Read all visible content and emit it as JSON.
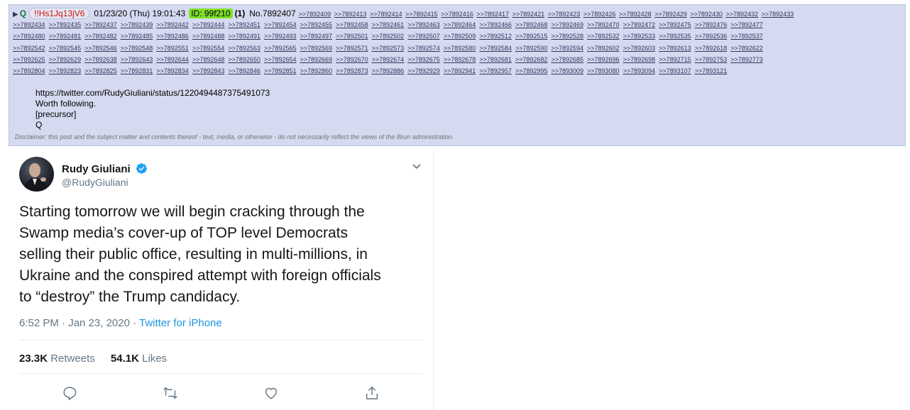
{
  "post": {
    "marker": "▶",
    "name": "Q",
    "tripcode": "!!Hs1Jq13jV6",
    "date": "01/23/20 (Thu) 19:01:43",
    "id_label": "ID: 99f210",
    "count": "(1)",
    "number": "No.7892407",
    "head_replies": [
      ">>7892409",
      ">>7892413",
      ">>7892414",
      ">>7892415",
      ">>7892416",
      ">>7892417",
      ">>7892421",
      ">>7892423",
      ">>7892426",
      ">>7892428",
      ">>7892429",
      ">>7892430",
      ">>7892432",
      ">>7892433"
    ],
    "reply_rows": [
      [
        ">>7892434",
        ">>7892435",
        ">>7892437",
        ">>7892439",
        ">>7892442",
        ">>7892444",
        ">>7892451",
        ">>7892454",
        ">>7892455",
        ">>7892458",
        ">>7892461",
        ">>7892463",
        ">>7892464",
        ">>7892466",
        ">>7892468",
        ">>7892469",
        ">>7892470",
        ">>7892472",
        ">>7892475",
        ">>7892476",
        ">>7892477"
      ],
      [
        ">>7892480",
        ">>7892481",
        ">>7892482",
        ">>7892485",
        ">>7892486",
        ">>7892488",
        ">>7892491",
        ">>7892493",
        ">>7892497",
        ">>7892501",
        ">>7892502",
        ">>7892507",
        ">>7892509",
        ">>7892512",
        ">>7892515",
        ">>7892528",
        ">>7892532",
        ">>7892533",
        ">>7892535",
        ">>7892536",
        ">>7892537"
      ],
      [
        ">>7892542",
        ">>7892545",
        ">>7892546",
        ">>7892548",
        ">>7892551",
        ">>7892554",
        ">>7892563",
        ">>7892565",
        ">>7892569",
        ">>7892571",
        ">>7892573",
        ">>7892574",
        ">>7892580",
        ">>7892584",
        ">>7892590",
        ">>7892594",
        ">>7892602",
        ">>7892603",
        ">>7892613",
        ">>7892618",
        ">>7892622"
      ],
      [
        ">>7892625",
        ">>7892629",
        ">>7892638",
        ">>7892643",
        ">>7892644",
        ">>7892648",
        ">>7892650",
        ">>7892654",
        ">>7892669",
        ">>7892670",
        ">>7892674",
        ">>7892675",
        ">>7892678",
        ">>7892681",
        ">>7892682",
        ">>7892685",
        ">>7892696",
        ">>7892698",
        ">>7892715",
        ">>7892753",
        ">>7892773"
      ],
      [
        ">>7892804",
        ">>7892823",
        ">>7892825",
        ">>7892831",
        ">>7892834",
        ">>7892843",
        ">>7892846",
        ">>7892851",
        ">>7892860",
        ">>7892873",
        ">>7892886",
        ">>7892929",
        ">>7892941",
        ">>7892957",
        ">>7892995",
        ">>7893009",
        ">>7893080",
        ">>7893094",
        ">>7893107",
        ">>7893121"
      ]
    ],
    "body_lines": [
      "https://twitter.com/RudyGiuliani/status/1220494487375491073",
      "Worth following.",
      "[precursor]",
      "Q"
    ],
    "disclaimer": "Disclaimer: this post and the subject matter and contents thereof - text, media, or otherwise - do not necessarily reflect the views of the 8kun administration."
  },
  "tweet": {
    "display_name": "Rudy Giuliani",
    "handle": "@RudyGiuliani",
    "lines": [
      "Starting tomorrow we will begin cracking through the",
      "Swamp media’s cover-up of TOP level Democrats",
      "selling their public office, resulting in multi-millions, in",
      "Ukraine and the conspired attempt with foreign officials",
      "to “destroy” the Trump candidacy."
    ],
    "time": "6:52 PM · Jan 23, 2020 · ",
    "source": "Twitter for iPhone",
    "retweets_count": "23.3K",
    "retweets_label": "Retweets",
    "likes_count": "54.1K",
    "likes_label": "Likes"
  },
  "icons": [
    "verified-badge-icon",
    "chevron-down-icon",
    "reply-icon",
    "retweet-icon",
    "like-icon",
    "share-icon"
  ],
  "colors": {
    "post_bg": "#d6daf0",
    "name": "#117743",
    "tripcode": "#cc1105",
    "id_highlight": "#7fe029",
    "link": "#34345c",
    "twitter_blue": "#1b95e0",
    "muted": "#657786"
  }
}
